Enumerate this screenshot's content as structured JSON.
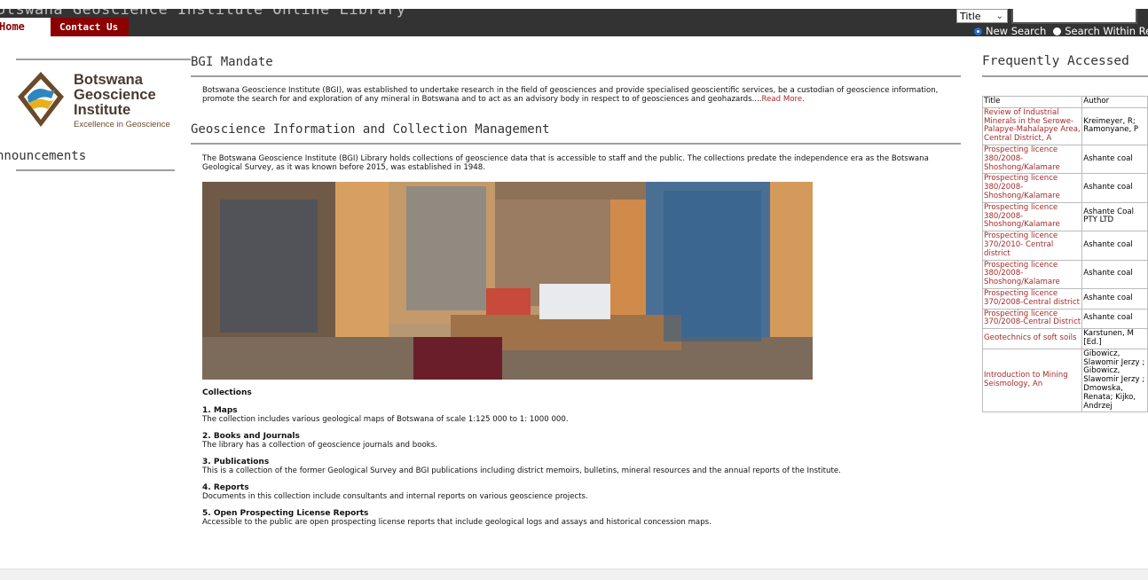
{
  "header": {
    "site_title": "otswana Geoscience Institute Online Library",
    "nav": {
      "home": "Home",
      "contact": "Contact Us"
    },
    "search": {
      "field_select": "Title",
      "query": "",
      "options": [
        "New Search",
        "Search Within Re"
      ]
    }
  },
  "sidebar": {
    "logo_name": "Botswana Geoscience Institute",
    "logo_name_lines": [
      "Botswana",
      "Geoscience",
      "Institute"
    ],
    "logo_tagline": "Excellence in Geoscience",
    "announcements": "nnouncements"
  },
  "main": {
    "mandate_title": "BGI Mandate",
    "mandate_text": "Botswana Geoscience Institute (BGI), was established to undertake research in the field of geosciences and provide specialised geoscientific services, be a custodian of geoscience information, promote the search for and exploration of any mineral in Botswana and to act as an advisory body in respect to of geosciences and geohazards....",
    "mandate_more": "Read More.",
    "gicm_title": "Geoscience Information and Collection Management",
    "gicm_text": "The Botswana Geoscience Institute (BGI) Library holds collections of geoscience data that is accessible to staff and the public. The collections predate the independence era as the Botswana Geological Survey, as it was known before 2015, was established in 1948.",
    "collections_title": "Collections",
    "collections": [
      {
        "title": "1. Maps",
        "text": "The collection includes various geological maps of Botswana of scale 1:125 000 to 1: 1000 000."
      },
      {
        "title": "2. Books and Journals",
        "text": "The library has a collection of geoscience journals and books."
      },
      {
        "title": "3. Publications",
        "text": "This is a collection of the former Geological Survey and BGI publications including district memoirs, bulletins, mineral resources and the annual reports of the Institute."
      },
      {
        "title": "4. Reports",
        "text": "Documents in this collection include consultants and internal reports on various geoscience projects."
      },
      {
        "title": "5. Open Prospecting License Reports",
        "text": "Accessible to the public are open prospecting license reports that include geological logs and assays and historical concession maps."
      }
    ]
  },
  "frequently_accessed": {
    "title": "Frequently Accessed",
    "columns": [
      "Title",
      "Author"
    ],
    "rows": [
      {
        "title": "Review of Industrial Minerals in the Serowe-Palapye-Mahalapye Area, Central District, A",
        "author": "Kreimeyer, R; Ramonyane, P"
      },
      {
        "title": "Prospecting licence 380/2008-Shoshong/Kalamare",
        "author": "Ashante coal"
      },
      {
        "title": "Prospecting licence 380/2008-Shoshong/Kalamare",
        "author": "Ashante coal"
      },
      {
        "title": "Prospecting licence 380/2008-Shoshong/Kalamare",
        "author": "Ashante Coal PTY LTD"
      },
      {
        "title": "Prospecting licence 370/2010- Central district",
        "author": "Ashante coal"
      },
      {
        "title": "Prospecting licence 380/2008-Shoshong/Kalamare",
        "author": "Ashante coal"
      },
      {
        "title": "Prospecting licence 370/2008-Central district",
        "author": "Ashante coal"
      },
      {
        "title": "Prospecting licence 370/2008-Central District",
        "author": "Ashante coal"
      },
      {
        "title": "Geotechnics of soft soils",
        "author": "Karstunen, M [Ed.]"
      },
      {
        "title": "Introduction to Mining Seismology, An",
        "author": "Gibowicz, Slawomir Jerzy ; Gibowicz, Slawomir Jerzy ; Dmowska, Renata; Kijko, Andrzej"
      }
    ]
  },
  "colors": {
    "accent": "#8b0000",
    "link": "#a52a2a",
    "header_bg": "#333333"
  }
}
